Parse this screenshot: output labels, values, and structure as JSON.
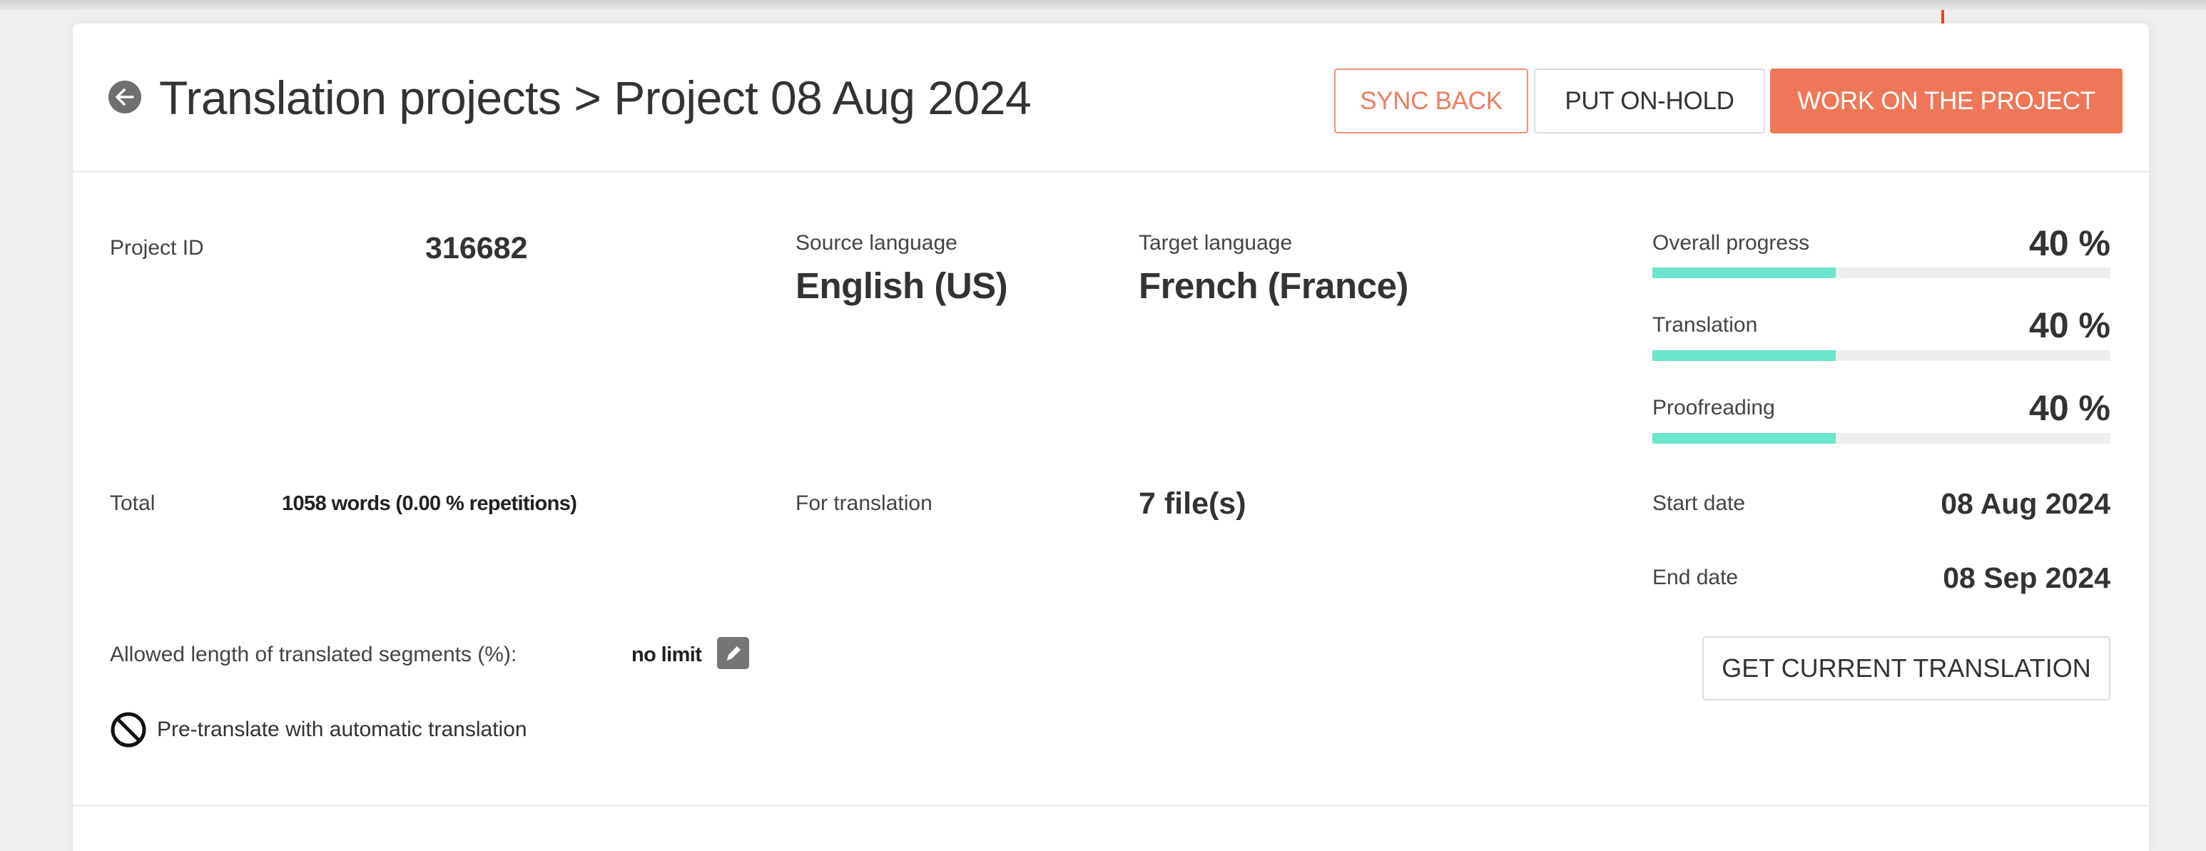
{
  "header": {
    "breadcrumb_root": "Translation projects",
    "separator": ">",
    "current": "Project 08 Aug 2024",
    "back_icon": "arrow-circle-left"
  },
  "actions": {
    "sync_back": "SYNC BACK",
    "put_on_hold": "PUT ON-HOLD",
    "work_on_project": "WORK ON THE PROJECT"
  },
  "details": {
    "project_id_label": "Project ID",
    "project_id": "316682",
    "source_language_label": "Source language",
    "source_language": "English (US)",
    "target_language_label": "Target language",
    "target_language": "French (France)",
    "total_label": "Total",
    "total_value": "1058 words (0.00 % repetitions)",
    "for_translation_label": "For translation",
    "for_translation_value": "7 file(s)",
    "allowed_length_label": "Allowed length of translated segments (%):",
    "allowed_length_value": "no limit",
    "pretranslate_label": "Pre-translate with automatic translation",
    "pretranslate_icon": "ban"
  },
  "progress": [
    {
      "label": "Overall progress",
      "value_text": "40 %",
      "percent": 40
    },
    {
      "label": "Translation",
      "value_text": "40 %",
      "percent": 40
    },
    {
      "label": "Proofreading",
      "value_text": "40 %",
      "percent": 40
    }
  ],
  "dates": {
    "start_label": "Start date",
    "start_value": "08 Aug 2024",
    "end_label": "End date",
    "end_value": "08 Sep 2024"
  },
  "get_translation_button": "GET CURRENT TRANSLATION",
  "colors": {
    "accent": "#ef7757",
    "accent_outline": "#f0927a",
    "progress_fill": "#6ce5cd",
    "progress_track": "#eeeeee",
    "annotation_arrow": "#e8442a"
  }
}
